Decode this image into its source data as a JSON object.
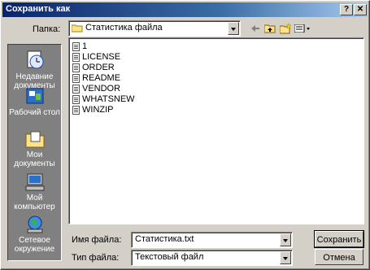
{
  "window": {
    "title": "Сохранить как"
  },
  "titlebar": {
    "help_label": "?",
    "close_label": "✕"
  },
  "toolbar": {
    "folder_label": "Папка:",
    "folder_value": "Статистика файла",
    "back_icon": "back-arrow-icon",
    "up_icon": "folder-up-icon",
    "new_folder_icon": "new-folder-icon",
    "view_icon": "view-menu-icon"
  },
  "places": [
    {
      "label_line1": "Недавние",
      "label_line2": "документы",
      "icon": "recent-documents-icon"
    },
    {
      "label_line1": "Рабочий стол",
      "label_line2": "",
      "icon": "desktop-icon"
    },
    {
      "label_line1": "Мои",
      "label_line2": "документы",
      "icon": "my-documents-icon"
    },
    {
      "label_line1": "Мой",
      "label_line2": "компьютер",
      "icon": "my-computer-icon"
    },
    {
      "label_line1": "Сетевое",
      "label_line2": "окружение",
      "icon": "network-icon"
    }
  ],
  "files": [
    "1",
    "LICENSE",
    "ORDER",
    "README",
    "VENDOR",
    "WHATSNEW",
    "WINZIP"
  ],
  "form": {
    "filename_label": "Имя файла:",
    "filename_value": "Статистика.txt",
    "filetype_label": "Тип файла:",
    "filetype_value": "Текстовый файл"
  },
  "buttons": {
    "save_label": "Сохранить",
    "cancel_label": "Отмена"
  }
}
